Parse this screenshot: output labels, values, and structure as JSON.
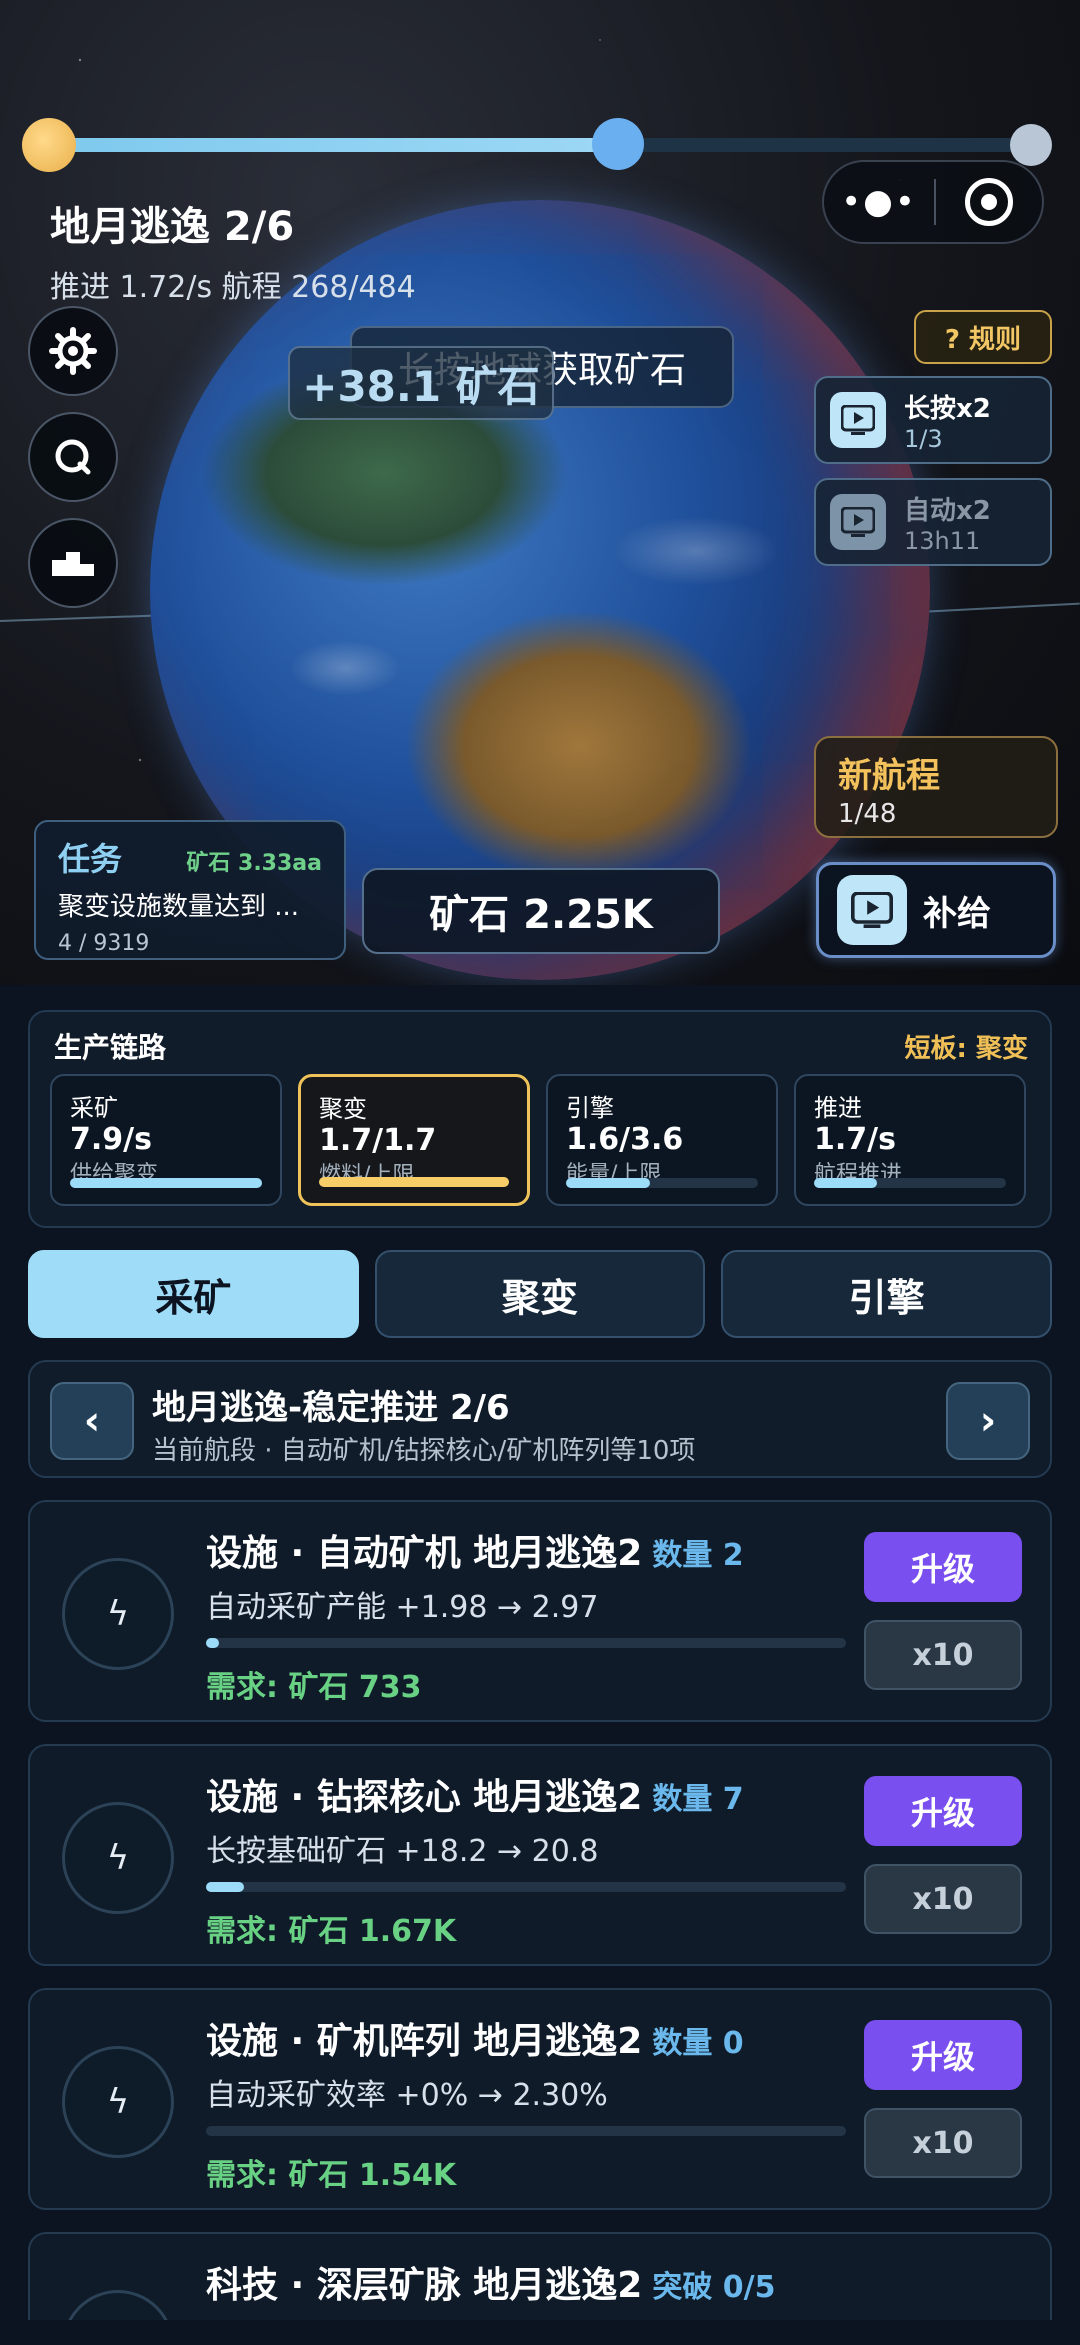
{
  "progress": {
    "value": 0.58
  },
  "level": {
    "title": "地月逃逸  2/6",
    "stats": "推进 1.72/s  航程 268/484"
  },
  "capsule": {
    "more": "•●•"
  },
  "hint": {
    "text": "长按地球获取矿石",
    "gain": "+38.1 矿石"
  },
  "rules_label": "? 规则",
  "boosts": [
    {
      "label": "长按x2",
      "sub": "1/3",
      "active": true
    },
    {
      "label": "自动x2",
      "sub": "13h11",
      "active": false
    }
  ],
  "new_route": {
    "title": "新航程",
    "progress": "1/48"
  },
  "supply_label": "补给",
  "task": {
    "title": "任务",
    "reward": "矿石 3.33aa",
    "desc": "聚变设施数量达到 ...",
    "progress": "4 / 9319"
  },
  "ore_total": "矿石 2.25K",
  "chain": {
    "title": "生产链路",
    "weak": "短板: 聚变",
    "stages": [
      {
        "name": "采矿",
        "value": "7.9/s",
        "desc": "供给聚变",
        "fill": 1.0,
        "highlight": false
      },
      {
        "name": "聚变",
        "value": "1.7/1.7",
        "desc": "燃料/上限",
        "fill": 1.0,
        "highlight": true
      },
      {
        "name": "引擎",
        "value": "1.6/3.6",
        "desc": "能量/上限",
        "fill": 0.44,
        "highlight": false
      },
      {
        "name": "推进",
        "value": "1.7/s",
        "desc": "航程推进",
        "fill": 0.33,
        "highlight": false
      }
    ]
  },
  "tabs": [
    {
      "label": "采矿",
      "active": true
    },
    {
      "label": "聚变",
      "active": false
    },
    {
      "label": "引擎",
      "active": false
    }
  ],
  "stage_nav": {
    "prev": "‹",
    "next": "›",
    "title": "地月逃逸-稳定推进 2/6",
    "subtitle": "当前航段 · 自动矿机/钻探核心/矿机阵列等10项"
  },
  "cards": [
    {
      "name": "设施 · 自动矿机 地月逃逸2",
      "count": "数量 2",
      "effect": "自动采矿产能 +1.98 → 2.97",
      "fill": 0.02,
      "req": "需求: 矿石 733",
      "upgrade": "升级",
      "x10": "x10"
    },
    {
      "name": "设施 · 钻探核心 地月逃逸2",
      "count": "数量 7",
      "effect": "长按基础矿石 +18.2 → 20.8",
      "fill": 0.06,
      "req": "需求: 矿石 1.67K",
      "upgrade": "升级",
      "x10": "x10"
    },
    {
      "name": "设施 · 矿机阵列 地月逃逸2",
      "count": "数量 0",
      "effect": "自动采矿效率 +0% → 2.30%",
      "fill": 0.0,
      "req": "需求: 矿石 1.54K",
      "upgrade": "升级",
      "x10": "x10"
    }
  ],
  "partial_card": {
    "name": "科技 · 深层矿脉 地月逃逸2",
    "breakthrough": "突破 0/5"
  },
  "icons": {
    "card_icon": "lightning-icon"
  }
}
